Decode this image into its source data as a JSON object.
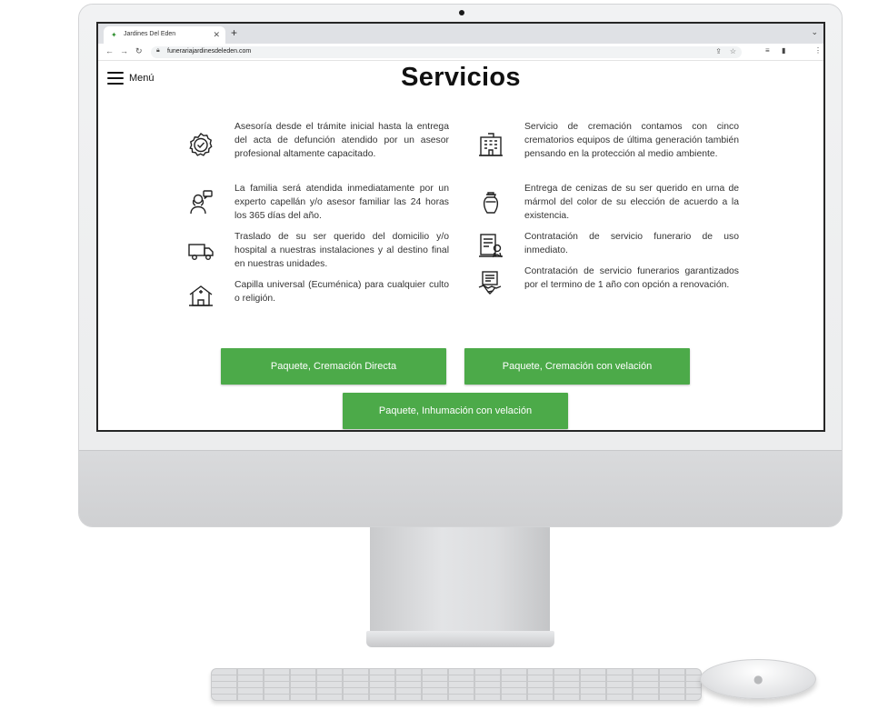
{
  "browser": {
    "tab_title": "Jardines Del Eden",
    "url": "funerariajardinesdeleden.com"
  },
  "page": {
    "menu_label": "Menú",
    "title": "Servicios"
  },
  "services_left": [
    {
      "icon": "badge-check-icon",
      "text": "Asesoría desde el trámite inicial hasta la entrega del acta de defunción atendido por un asesor profesional altamente capacitado."
    },
    {
      "icon": "advisor-chat-icon",
      "text": "La familia será atendida inmediatamente por un experto capellán y/o asesor familiar las 24 horas los 365 días del año."
    },
    {
      "icon": "truck-icon",
      "text": "Traslado de su ser querido del domicilio y/o hospital a nuestras instalaciones y al destino final en nuestras unidades."
    },
    {
      "icon": "chapel-icon",
      "text": "Capilla universal (Ecuménica) para cualquier culto o religión."
    }
  ],
  "services_right": [
    {
      "icon": "crematorium-building-icon",
      "text": "Servicio de cremación contamos con cinco crematorios equipos de última generación también pensando en la protección al medio ambiente."
    },
    {
      "icon": "urn-icon",
      "text": "Entrega de cenizas de su ser querido en urna de mármol del color de su elección de acuerdo a la existencia."
    },
    {
      "icon": "contract-document-icon",
      "text": "Contratación de servicio funerario de uso inmediato."
    },
    {
      "icon": "handshake-document-icon",
      "text": "Contratación de servicio funerarios garantizados por el termino de 1 año con opción a renovación."
    }
  ],
  "buttons": {
    "cremacion_directa": "Paquete, Cremación Directa",
    "cremacion_velacion": "Paquete, Cremación con velación",
    "inhumacion_velacion": "Paquete, Inhumación con velación"
  },
  "colors": {
    "button_green": "#4caa49",
    "text_dark": "#111111"
  }
}
